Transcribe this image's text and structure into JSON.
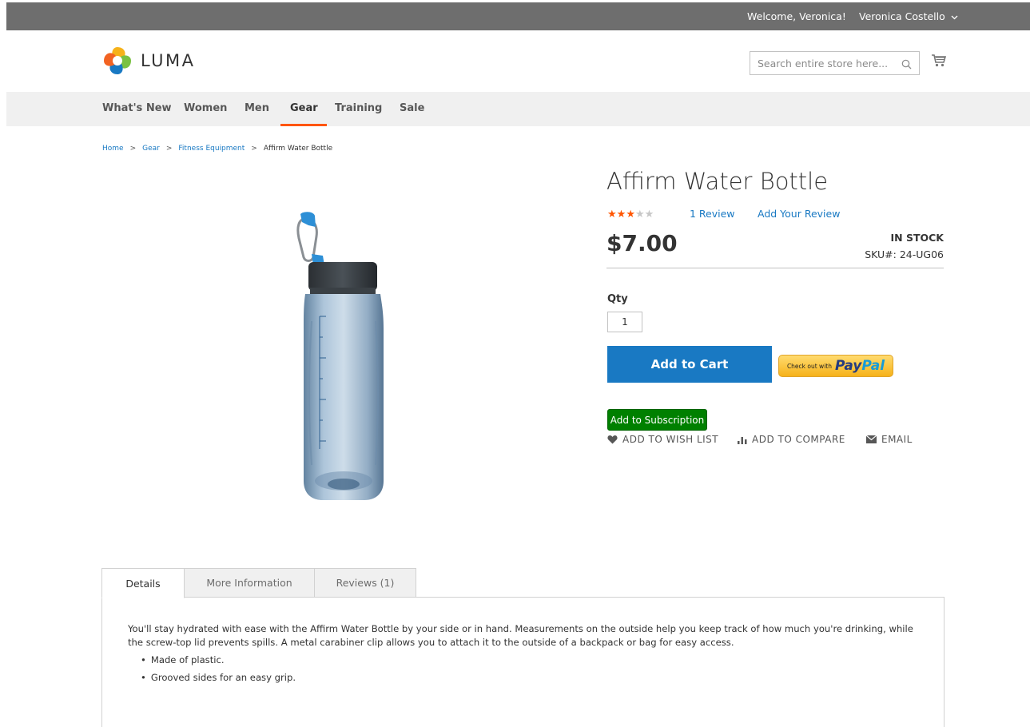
{
  "topbar": {
    "welcome": "Welcome, Veronica!",
    "account_name": "Veronica Costello"
  },
  "header": {
    "logo_text": "LUMA",
    "search_placeholder": "Search entire store here..."
  },
  "nav": {
    "items": [
      "What's New",
      "Women",
      "Men",
      "Gear",
      "Training",
      "Sale"
    ],
    "active": "Gear"
  },
  "breadcrumb": {
    "items": [
      "Home",
      "Gear",
      "Fitness Equipment",
      "Affirm Water Bottle"
    ]
  },
  "product": {
    "title": "Affirm Water Bottle",
    "rating": 3,
    "rating_max": 5,
    "review_link": "1 Review",
    "add_review": "Add Your Review",
    "price": "$7.00",
    "stock": "IN STOCK",
    "sku": "SKU#:  24-UG06",
    "qty_label": "Qty",
    "qty_value": "1",
    "add_to_cart": "Add to Cart",
    "paypal_small": "Check out with",
    "paypal_pay": "Pay",
    "paypal_pal": "Pal",
    "subscribe": "Add to Subscription",
    "wishlist": "ADD TO WISH LIST",
    "compare": "ADD TO COMPARE",
    "email": "EMAIL"
  },
  "tabs": {
    "details": "Details",
    "more_info": "More Information",
    "reviews": "Reviews (1)",
    "active": "Details",
    "description": "You'll stay hydrated with ease with the Affirm Water Bottle by your side or in hand. Measurements on the outside help you keep track of how much you're drinking, while the screw-top lid prevents spills. A metal carabiner clip allows you to attach it to the outside of a backpack or bag for easy access.",
    "features": [
      "Made of plastic.",
      "Grooved sides for an easy grip."
    ]
  },
  "colors": {
    "accent": "#1979c3",
    "nav_active": "#ff5501",
    "topbar": "#6e6e6e",
    "subscribe": "#008000",
    "star": "#ff5501"
  }
}
